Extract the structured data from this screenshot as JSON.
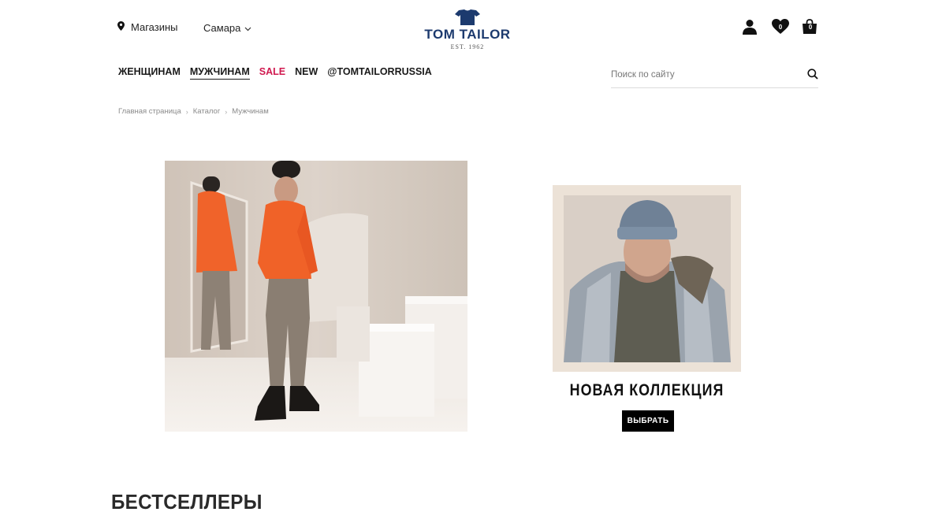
{
  "header": {
    "store_link": {
      "label": "Магазины",
      "icon": "location-pin-icon"
    },
    "city": {
      "label": "Самара",
      "icon": "chevron-down-icon"
    },
    "logo": {
      "brand": "TOM TAILOR",
      "est": "EST. 1962",
      "icon": "shirt-icon"
    },
    "icons": {
      "account": "user-icon",
      "wishlist": {
        "icon": "heart-icon",
        "count": "0"
      },
      "cart": {
        "icon": "shopping-bag-icon",
        "count": "0"
      }
    }
  },
  "nav": {
    "items": [
      {
        "label": "ЖЕНЩИНАМ"
      },
      {
        "label": "МУЖЧИНАМ",
        "active": true
      },
      {
        "label": "SALE",
        "color": "#d0194f"
      },
      {
        "label": "NEW"
      },
      {
        "label": "@TOMTAILORRUSSIA"
      }
    ]
  },
  "search": {
    "placeholder": "Поиск по сайту",
    "value": "",
    "icon": "search-icon"
  },
  "breadcrumb": {
    "items": [
      "Главная страница",
      "Каталог",
      "Мужчинам"
    ]
  },
  "promo": {
    "title": "НОВАЯ КОЛЛЕКЦИЯ",
    "button_label": "ВЫБРАТЬ"
  },
  "sections": {
    "bestsellers_title": "БЕСТСЕЛЛЕРЫ"
  },
  "colors": {
    "brand": "#1c3a6e",
    "sale": "#d0194f",
    "button_bg": "#000000",
    "promo_frame": "#ece2d7"
  }
}
